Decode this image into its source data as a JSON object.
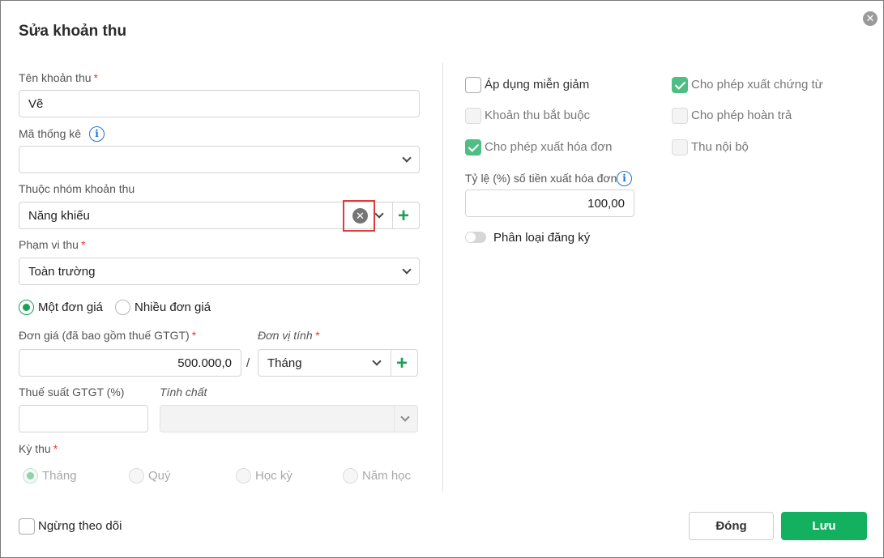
{
  "dialog": {
    "title": "Sửa khoản thu",
    "close_icon": "close-icon"
  },
  "fields": {
    "ten_khoan_thu": {
      "label": "Tên khoản thu",
      "required": "*",
      "value": "Vẽ"
    },
    "ma_thong_ke": {
      "label": "Mã thống kê",
      "value": ""
    },
    "nhom_khoan_thu": {
      "label": "Thuộc nhóm khoản thu",
      "value": "Năng khiếu"
    },
    "pham_vi_thu": {
      "label": "Phạm vi thu",
      "required": "*",
      "value": "Toàn trường"
    },
    "don_gia_mode": {
      "options": [
        "Một đơn giá",
        "Nhiều đơn giá"
      ],
      "selected": "Một đơn giá"
    },
    "don_gia": {
      "label": "Đơn giá (đã bao gồm thuế GTGT)",
      "required": "*",
      "value": "500.000,0"
    },
    "slash": "/",
    "don_vi_tinh": {
      "label": "Đơn vị tính",
      "required": "*",
      "value": "Tháng"
    },
    "thue_suat": {
      "label": "Thuế suất GTGT (%)",
      "value": ""
    },
    "tinh_chat": {
      "label": "Tính chất",
      "value": ""
    },
    "ky_thu": {
      "label": "Kỳ thu",
      "required": "*",
      "options": [
        "Tháng",
        "Quý",
        "Học kỳ",
        "Năm học"
      ],
      "selected": "Tháng"
    }
  },
  "options": {
    "ap_dung_mien_giam": {
      "label": "Áp dụng miễn giảm",
      "checked": false
    },
    "cho_phep_xuat_chung_tu": {
      "label": "Cho phép xuất chứng từ",
      "checked": true
    },
    "khoan_thu_bat_buoc": {
      "label": "Khoản thu bắt buộc",
      "checked": false
    },
    "cho_phep_hoan_tra": {
      "label": "Cho phép hoàn trả",
      "checked": false
    },
    "cho_phep_xuat_hoa_don": {
      "label": "Cho phép xuất hóa đơn",
      "checked": true
    },
    "thu_noi_bo": {
      "label": "Thu nội bộ",
      "checked": false
    },
    "ty_le": {
      "label": "Tỷ lệ (%) số tiền xuất hóa đơn",
      "value": "100,00"
    },
    "phan_loai_dang_ky": {
      "label": "Phân loại đăng ký",
      "enabled": false
    }
  },
  "footer": {
    "ngung_theo_doi": {
      "label": "Ngừng theo dõi",
      "checked": false
    },
    "close_label": "Đóng",
    "save_label": "Lưu"
  },
  "colors": {
    "accent": "#12b05f",
    "required": "#e53935",
    "info": "#1e73d8",
    "highlight": "#e03b3b"
  }
}
